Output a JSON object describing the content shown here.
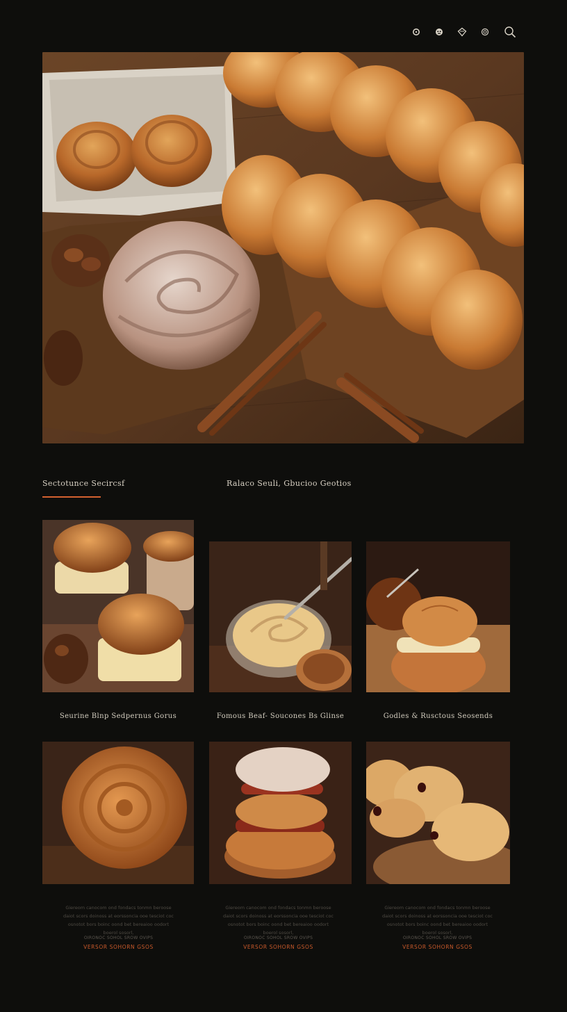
{
  "colors": {
    "background": "#0e0e0c",
    "accent": "#d4622f",
    "text": "#d9d3c8"
  },
  "header": {
    "icons": [
      "user-icon",
      "cart-icon",
      "diamond-icon",
      "settings-icon",
      "search-icon"
    ]
  },
  "hero": {
    "image": "bread-loaves-cinnamon-photo"
  },
  "section": {
    "left_title": "Sectotunce Secircsf",
    "center_title": "Ralaco Seuli, Gbucioo Geotios"
  },
  "grid": {
    "row1": [
      {
        "image": "muffin-pastries-photo"
      },
      {
        "image": "cream-bowl-photo"
      },
      {
        "image": "cream-bun-photo"
      }
    ],
    "captions": [
      "Seurine Blnp Sedpernus Gorus",
      "Fomous Beaf- Soucones Bs Glinse",
      "Godles & Rusctous Seosends"
    ],
    "row2": [
      {
        "image": "swirl-roll-photo"
      },
      {
        "image": "filled-bun-photo"
      },
      {
        "image": "croissant-photo"
      }
    ],
    "details": [
      {
        "blurb": "Giereom canocom ond fondacs tonmn beroose daiot scors doinoss at eorssoncia ooe tesciot coc osnotot bors boinc oond bet bereaioo oodort boerol sosorl,",
        "meta": "OIRONOC SOHOL SROW OVIPS",
        "price": "VERSOR SOHORN GSOS"
      },
      {
        "blurb": "Giereom canocom ond fondacs tonmn beroose daiot scors doinoss at eorssoncia ooe tesciot coc osnotot bors boinc oond bet bereaioo oodort boerol sosorl,",
        "meta": "OIRONOC SOHOL SROW OVIPS",
        "price": "VERSOR SOHORN GSOS"
      },
      {
        "blurb": "Giereom canocom ond fondacs tonmn beroose daiot scors doinoss at eorssoncia ooe tesciot coc osnotot bors boinc oond bet bereaioo oodort boerol sosorl,",
        "meta": "OIRONOC SOHOL SROW OVIPS",
        "price": "VERSOR SOHORN GSOS"
      }
    ]
  }
}
